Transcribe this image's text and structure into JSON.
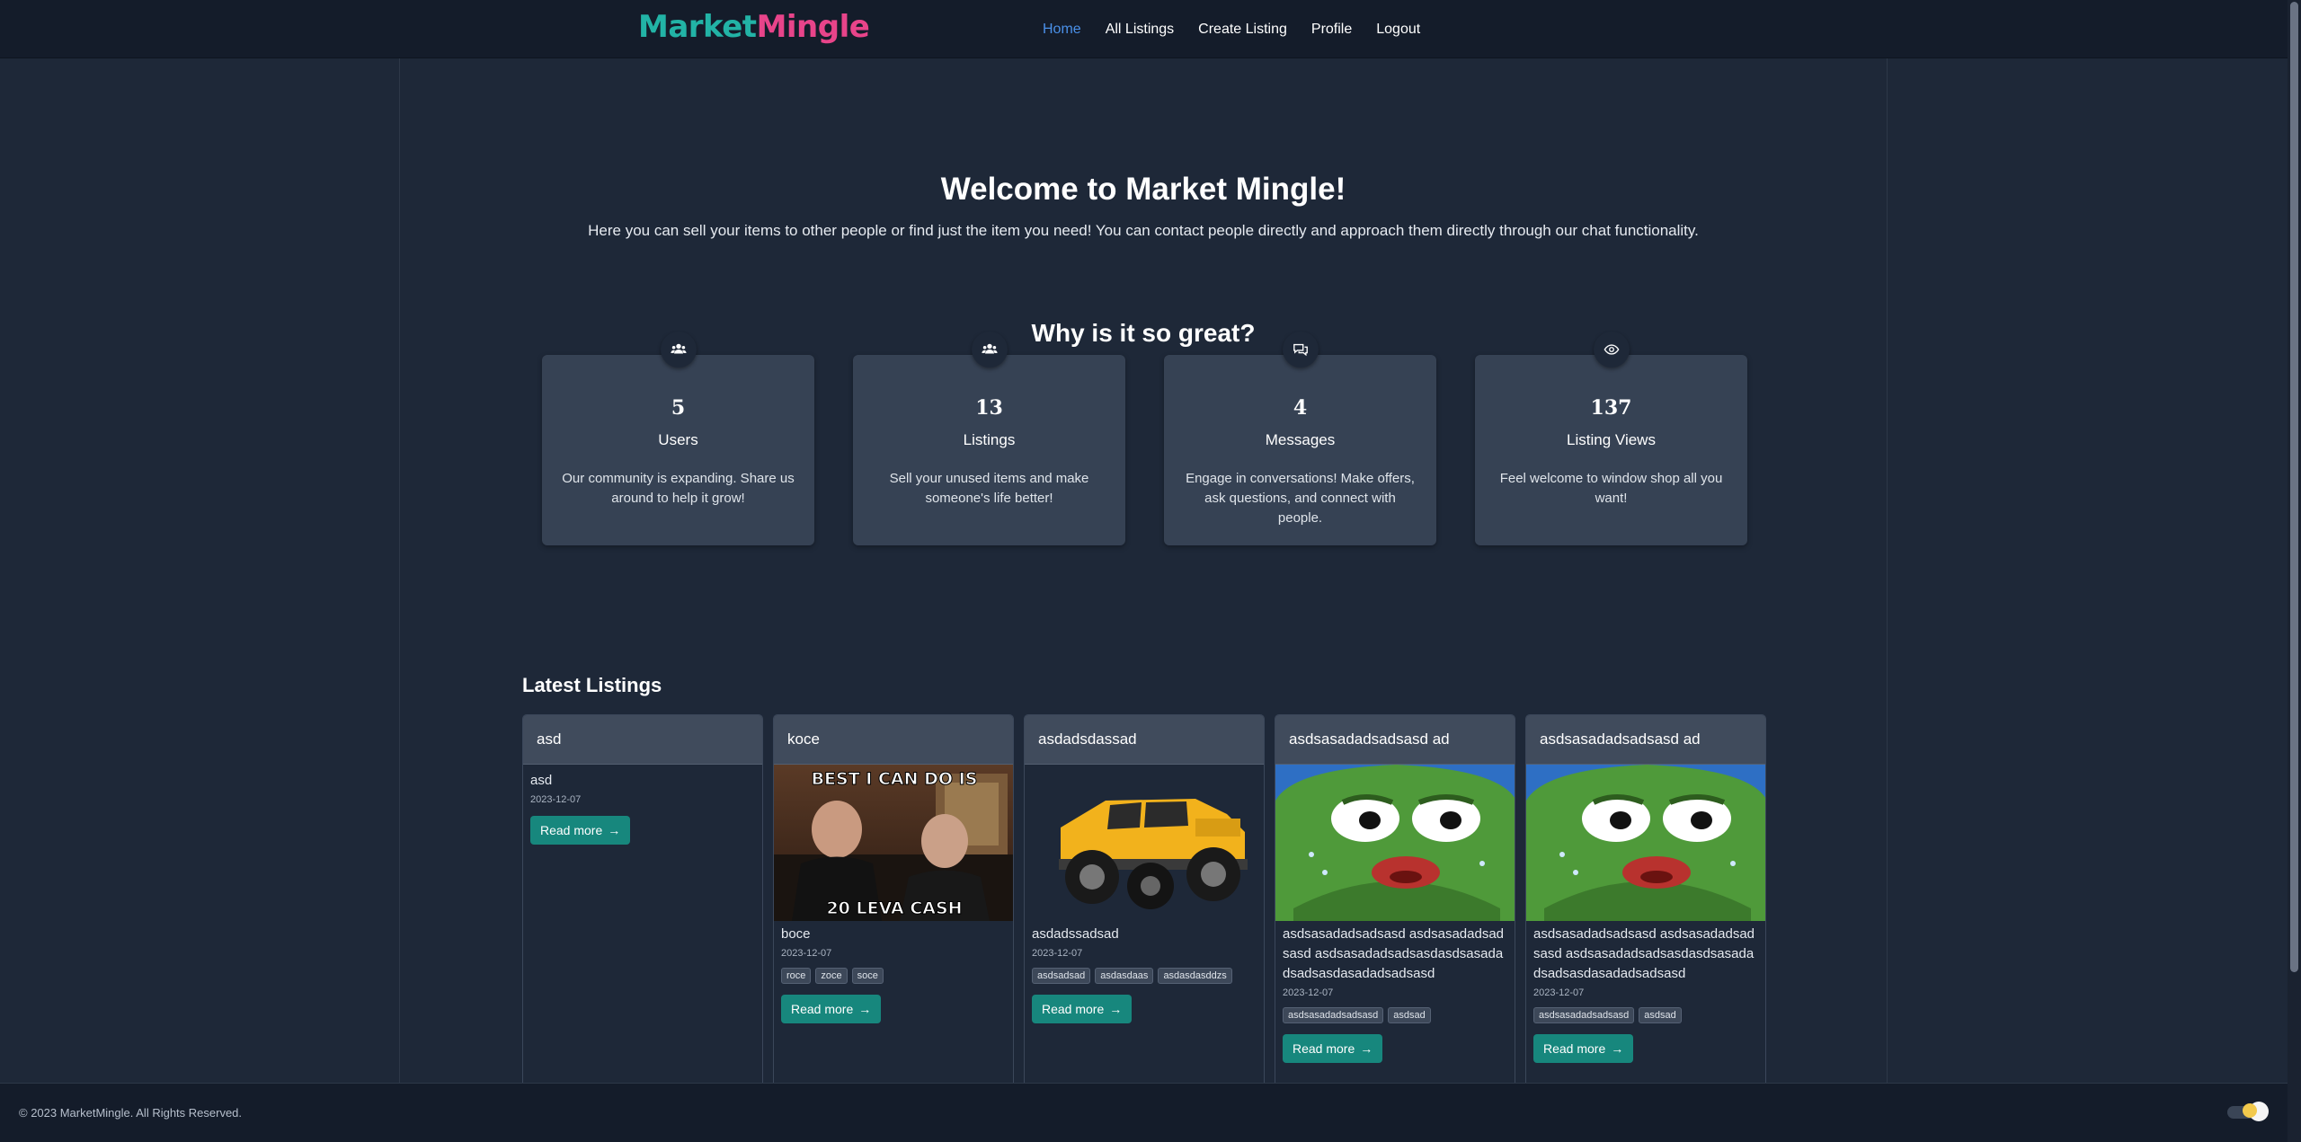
{
  "brand": {
    "part1": "Market",
    "part2": "Mingle"
  },
  "nav": {
    "home": "Home",
    "all_listings": "All Listings",
    "create_listing": "Create Listing",
    "profile": "Profile",
    "logout": "Logout"
  },
  "hero": {
    "title": "Welcome to Market Mingle!",
    "subtitle": "Here you can sell your items to other people or find just the item you need! You can contact people directly and approach them directly through our chat functionality."
  },
  "why": {
    "title": "Why is it so great?"
  },
  "stats": [
    {
      "icon": "users-icon",
      "number": "5",
      "label": "Users",
      "desc": "Our community is expanding. Share us around to help it grow!"
    },
    {
      "icon": "users-icon",
      "number": "13",
      "label": "Listings",
      "desc": "Sell your unused items and make someone's life better!"
    },
    {
      "icon": "chat-icon",
      "number": "4",
      "label": "Messages",
      "desc": "Engage in conversations! Make offers, ask questions, and connect with people."
    },
    {
      "icon": "eye-icon",
      "number": "137",
      "label": "Listing Views",
      "desc": "Feel welcome to window shop all you want!"
    }
  ],
  "latest": {
    "title": "Latest Listings",
    "read_more": "Read more",
    "items": [
      {
        "title": "asd",
        "text": "asd",
        "date": "2023-12-07",
        "tags": [],
        "image": "none"
      },
      {
        "title": "koce",
        "text": "boce",
        "date": "2023-12-07",
        "tags": [
          "roce",
          "zoce",
          "soce"
        ],
        "image": "meme-photo",
        "image_top_text": "BEST I CAN DO IS",
        "image_bottom_text": "20 LEVA CASH"
      },
      {
        "title": "asdadsdassad",
        "text": "asdadssadsad",
        "date": "2023-12-07",
        "tags": [
          "asdsadsad",
          "asdasdaas",
          "asdasdasddzs"
        ],
        "image": "yellow-toy-jeep"
      },
      {
        "title": "asdsasadadsadsasd ad",
        "text": "asdsasadadsadsasd asdsasadadsadsasd asdsasadadsadsasdasdsasadadsadsasdasadadsadsasd",
        "date": "2023-12-07",
        "tags": [
          "asdsasadadsadsasd",
          "asdsad"
        ],
        "image": "green-frog"
      },
      {
        "title": "asdsasadadsadsasd ad",
        "text": "asdsasadadsadsasd asdsasadadsadsasd asdsasadadsadsasdasdsasadadsadsasdasadadsadsasd",
        "date": "2023-12-07",
        "tags": [
          "asdsasadadsadsasd",
          "asdsad"
        ],
        "image": "green-frog"
      }
    ]
  },
  "footer": {
    "copyright": "© 2023 MarketMingle. All Rights Reserved."
  },
  "colors": {
    "brand_teal": "#22b3a6",
    "brand_pink": "#e8448a",
    "nav_active": "#4a90e8",
    "button": "#17877d",
    "background": "#1e2838",
    "card": "#364254"
  }
}
